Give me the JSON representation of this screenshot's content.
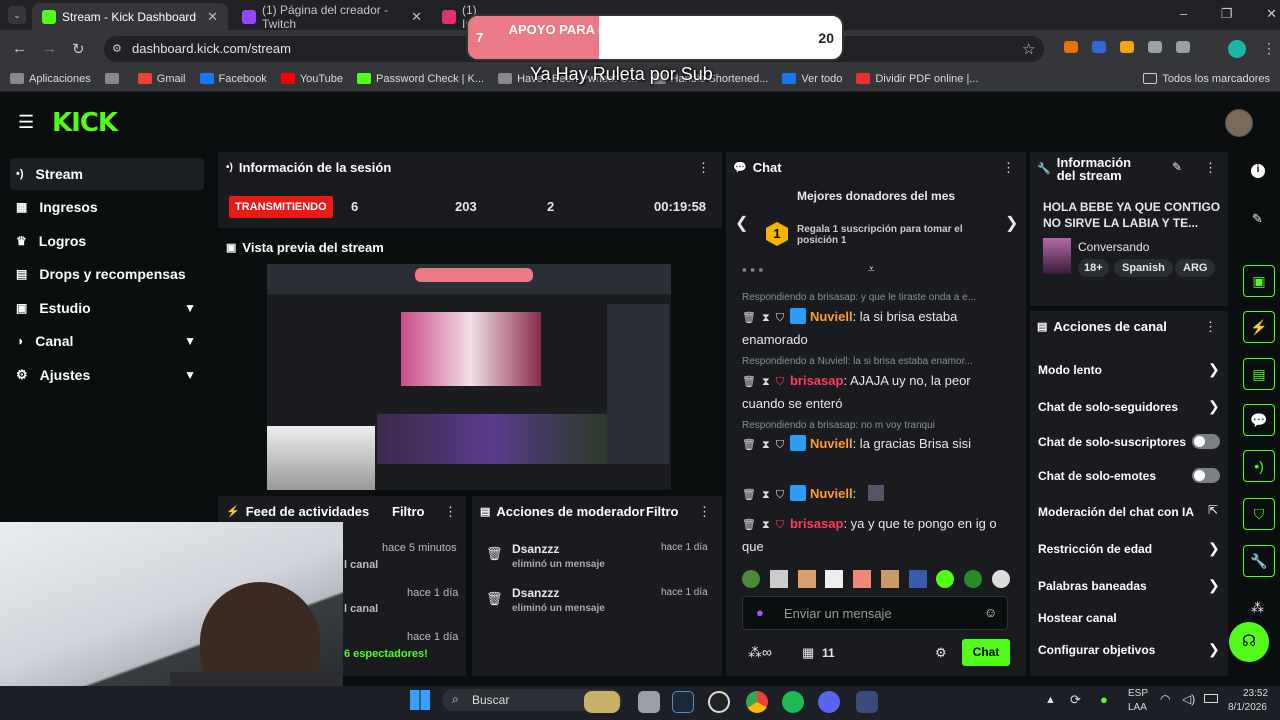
{
  "browser": {
    "tabs": [
      {
        "title": "Stream - Kick Dashboard",
        "color": "#53fc18"
      },
      {
        "title": "(1) Página del creador - Twitch",
        "color": "#9146ff"
      },
      {
        "title": "(1) In",
        "color": "#e1306c"
      }
    ],
    "url": "dashboard.kick.com/stream",
    "bookmarks": [
      {
        "label": "Aplicaciones",
        "color": "#888"
      },
      {
        "label": "",
        "color": "#888"
      },
      {
        "label": "Gmail",
        "color": "#ea4335"
      },
      {
        "label": "Facebook",
        "color": "#1877f2"
      },
      {
        "label": "YouTube",
        "color": "#ff0000"
      },
      {
        "label": "Password Check | K...",
        "color": "#53fc18"
      },
      {
        "label": "Have I Been Pwned: C...",
        "color": "#888"
      },
      {
        "label": "Handle Shortened...",
        "color": "#888"
      },
      {
        "label": "Ver todo",
        "color": "#1877f2"
      },
      {
        "label": "Dividir PDF online |...",
        "color": "#e5322d"
      }
    ],
    "bookmarks_all": "Todos los marcadores"
  },
  "overlay": {
    "goal": "APOYO PARA COMPRAR UNA BUENA CAMARA",
    "current": "7",
    "target": "20",
    "progress": 0.35,
    "ruleta": "Ya Hay Ruleta por Sub"
  },
  "sidebar": {
    "items": [
      {
        "label": "Stream",
        "icon": "•)"
      },
      {
        "label": "Ingresos",
        "icon": "▦"
      },
      {
        "label": "Logros",
        "icon": "♛"
      },
      {
        "label": "Drops y recompensas",
        "icon": "▤"
      },
      {
        "label": "Estudio",
        "icon": "▣"
      },
      {
        "label": "Canal",
        "icon": "◑"
      },
      {
        "label": "Ajustes",
        "icon": "⚙"
      }
    ]
  },
  "session": {
    "title": "Información de la sesión",
    "status": "TRANSMITIENDO",
    "stats": [
      "6",
      "203",
      "2"
    ],
    "time": "00:19:58"
  },
  "preview": {
    "title": "Vista previa del stream"
  },
  "feed": {
    "title": "Feed de actividades",
    "filter": "Filtro",
    "items": [
      {
        "time": "hace 5 minutos",
        "text": "l canal"
      },
      {
        "time": "hace 1 día",
        "text": "l canal"
      },
      {
        "time": "hace 1 día",
        "text": "6 espectadores!"
      }
    ]
  },
  "mod": {
    "title": "Acciones de moderador",
    "filter": "Filtro",
    "items": [
      {
        "user": "Dsanzzz",
        "action": "eliminó un mensaje",
        "time": "hace 1 día"
      },
      {
        "user": "Dsanzzz",
        "action": "eliminó un mensaje",
        "time": "hace 1 día"
      }
    ]
  },
  "chat": {
    "title": "Chat",
    "donors_title": "Mejores donadores del mes",
    "donor_rank": "1",
    "donor_text": "Regala 1 suscripción para tomar el posición 1",
    "messages": [
      {
        "reply": "Respondiendo a brisasap: y que le tiraste onda a e...",
        "user": "Nuviell",
        "text": ": la si brisa estaba enamorado",
        "cls": "orange"
      },
      {
        "reply": "Respondiendo a Nuviell: la si brisa estaba enamor...",
        "user": "brisasap",
        "text": ": AJAJA uy no, la peor cuando se enteró",
        "cls": "red"
      },
      {
        "reply": "Respondiendo a brisasap: no m voy tranqui",
        "user": "Nuviell",
        "text": ": la gracias Brisa sisi",
        "cls": "orange"
      },
      {
        "reply": "",
        "user": "Nuviell",
        "text": ":",
        "cls": "orange"
      },
      {
        "reply": "",
        "user": "brisasap",
        "text": ": ya y que te pongo en ig o que",
        "cls": "red"
      }
    ],
    "placeholder": "Enviar un mensaje",
    "count": "11",
    "send": "Chat"
  },
  "info": {
    "title": "Información del stream",
    "stream_title": "HOLA BEBE YA QUE CONTIGO NO SIRVE LA LABIA Y TE...",
    "category": "Conversando",
    "tags": [
      "18+",
      "Spanish",
      "ARG"
    ]
  },
  "actions": {
    "title": "Acciones de canal",
    "items": [
      {
        "label": "Modo lento",
        "kind": "arrow"
      },
      {
        "label": "Chat de solo-seguidores",
        "kind": "arrow"
      },
      {
        "label": "Chat de solo-suscriptores",
        "kind": "toggle"
      },
      {
        "label": "Chat de solo-emotes",
        "kind": "toggle"
      },
      {
        "label": "Moderación del chat con IA",
        "kind": "ext"
      },
      {
        "label": "Restricción de edad",
        "kind": "arrow"
      },
      {
        "label": "Palabras baneadas",
        "kind": "arrow"
      },
      {
        "label": "Hostear canal",
        "kind": "none"
      },
      {
        "label": "Configurar objetivos",
        "kind": "arrow"
      }
    ]
  },
  "taskbar": {
    "search": "Buscar",
    "lang1": "ESP",
    "lang2": "LAA",
    "time": "23:52",
    "date": "8/1/2026"
  }
}
